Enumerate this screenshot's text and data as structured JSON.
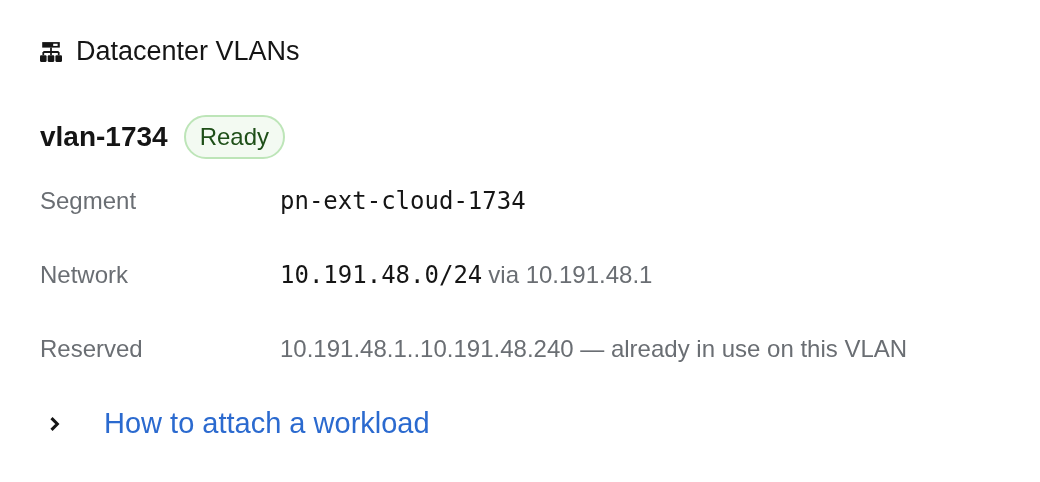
{
  "section": {
    "title": "Datacenter VLANs"
  },
  "vlan": {
    "name": "vlan-1734",
    "status": {
      "label": "Ready",
      "kind": "success"
    }
  },
  "details": [
    {
      "label": "Segment",
      "value": [
        {
          "kind": "code",
          "text": "pn-ext-cloud-1734"
        }
      ]
    },
    {
      "label": "Network",
      "value": [
        {
          "kind": "code",
          "text": "10.191.48.0/24"
        },
        {
          "kind": "muted",
          "text": "via 10.191.48.1"
        }
      ]
    },
    {
      "label": "Reserved",
      "value": [
        {
          "kind": "muted",
          "text": "10.191.48.1..10.191.48.240 — already in use on this VLAN"
        }
      ]
    }
  ],
  "expander": {
    "label": "How to attach a workload",
    "expanded": false
  }
}
